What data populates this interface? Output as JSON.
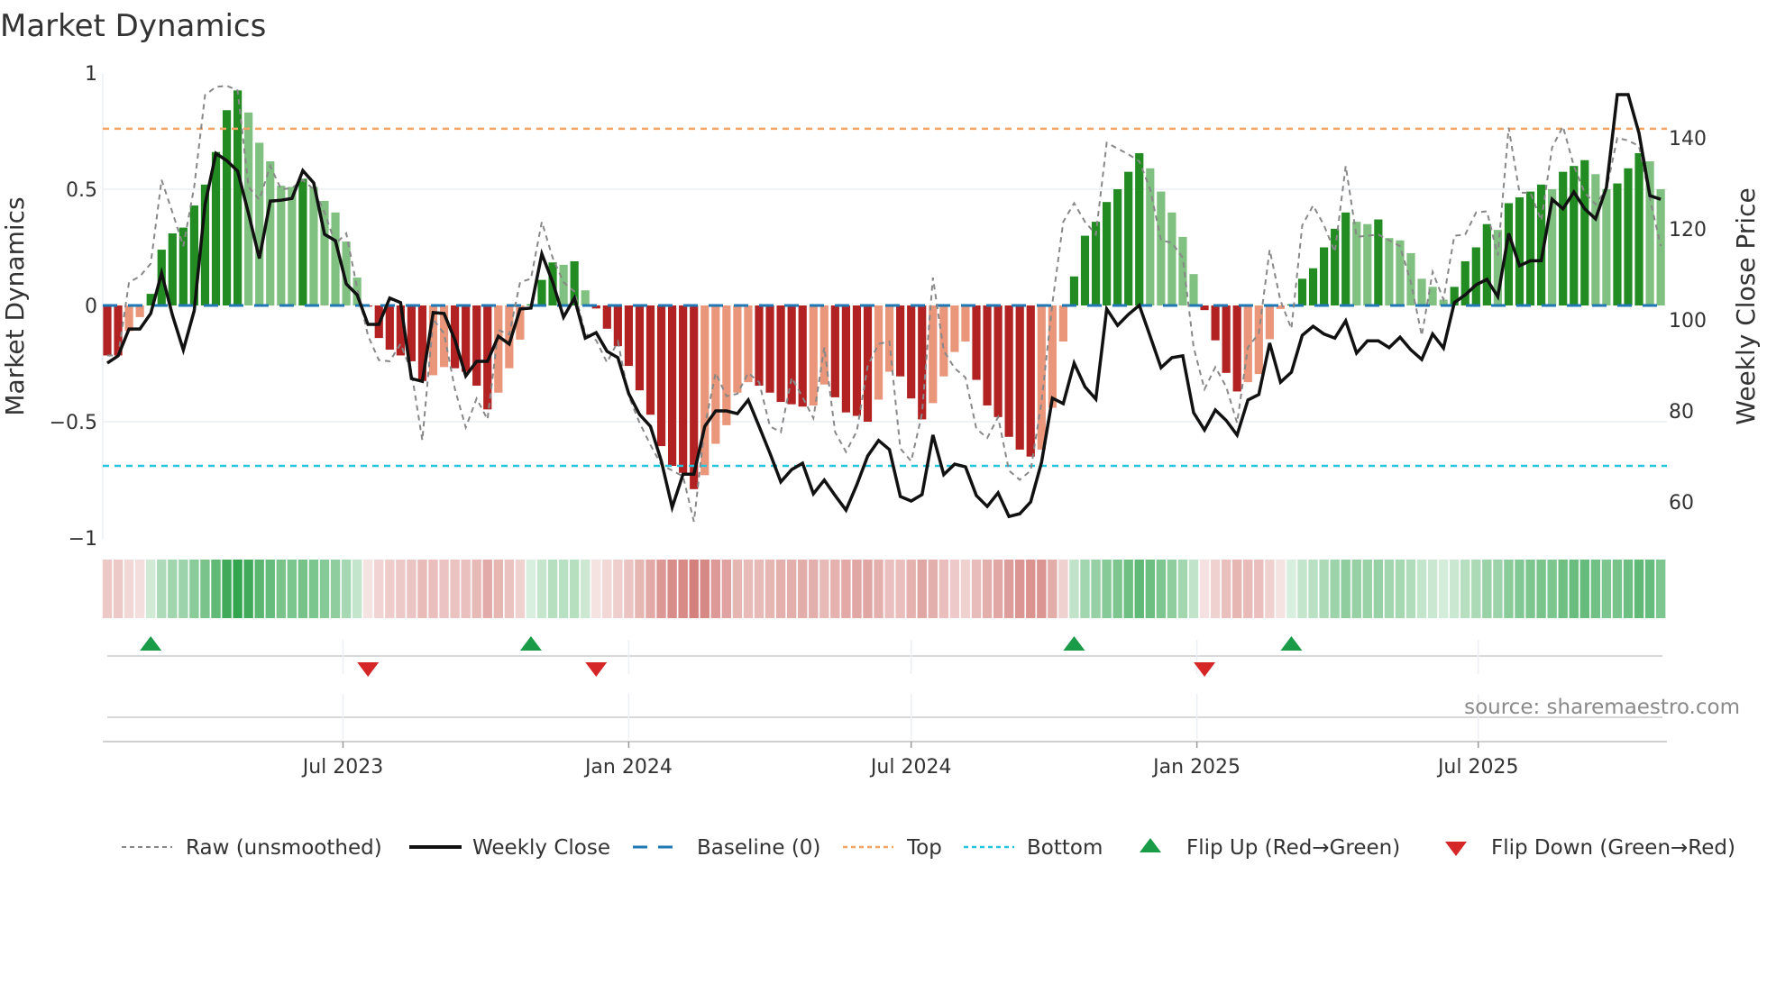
{
  "chart_data": {
    "type": "bar",
    "title": "Market Dynamics",
    "ylabel": "Market Dynamics",
    "ylabel_right": "Weekly Close Price",
    "ylim": [
      -1,
      1
    ],
    "ylim_right": [
      52,
      154
    ],
    "yticks": [
      {
        "v": 1,
        "label": "1"
      },
      {
        "v": 0.5,
        "label": "0.5"
      },
      {
        "v": 0,
        "label": "0"
      },
      {
        "v": -0.5,
        "label": "−0.5"
      },
      {
        "v": -1,
        "label": "−1"
      }
    ],
    "yticks_right": [
      {
        "v": 140,
        "label": "140"
      },
      {
        "v": 120,
        "label": "120"
      },
      {
        "v": 100,
        "label": "100"
      },
      {
        "v": 80,
        "label": "80"
      },
      {
        "v": 60,
        "label": "60"
      }
    ],
    "xticks": [
      {
        "week": 21.7,
        "label": "Jul 2023"
      },
      {
        "week": 48.0,
        "label": "Jan 2024"
      },
      {
        "week": 74.0,
        "label": "Jul 2024"
      },
      {
        "week": 100.3,
        "label": "Jan 2025"
      },
      {
        "week": 126.2,
        "label": "Jul 2025"
      }
    ],
    "top_threshold": 0.76,
    "bottom_threshold": -0.69,
    "baseline": 0,
    "smoothed": [
      -0.215,
      -0.215,
      -0.11,
      -0.05,
      0.05,
      0.24,
      0.31,
      0.335,
      0.43,
      0.52,
      0.66,
      0.84,
      0.925,
      0.83,
      0.7,
      0.62,
      0.515,
      0.51,
      0.545,
      0.51,
      0.45,
      0.4,
      0.275,
      0.12,
      -0.005,
      -0.14,
      -0.19,
      -0.215,
      -0.24,
      -0.325,
      -0.3,
      -0.265,
      -0.27,
      -0.285,
      -0.345,
      -0.447,
      -0.375,
      -0.27,
      -0.147,
      0.005,
      0.11,
      0.185,
      0.175,
      0.19,
      0.065,
      -0.013,
      -0.1,
      -0.175,
      -0.26,
      -0.365,
      -0.47,
      -0.605,
      -0.69,
      -0.72,
      -0.79,
      -0.73,
      -0.595,
      -0.515,
      -0.375,
      -0.33,
      -0.345,
      -0.375,
      -0.415,
      -0.425,
      -0.435,
      -0.43,
      -0.34,
      -0.395,
      -0.46,
      -0.475,
      -0.5,
      -0.405,
      -0.285,
      -0.305,
      -0.4,
      -0.49,
      -0.42,
      -0.305,
      -0.2,
      -0.155,
      -0.32,
      -0.43,
      -0.48,
      -0.565,
      -0.62,
      -0.65,
      -0.62,
      -0.44,
      -0.155,
      0.125,
      0.3,
      0.36,
      0.445,
      0.5,
      0.575,
      0.655,
      0.59,
      0.49,
      0.4,
      0.295,
      0.135,
      -0.02,
      -0.15,
      -0.29,
      -0.37,
      -0.33,
      -0.295,
      -0.145,
      -0.015,
      0.005,
      0.115,
      0.16,
      0.25,
      0.33,
      0.4,
      0.36,
      0.35,
      0.37,
      0.29,
      0.28,
      0.225,
      0.115,
      0.08,
      0.025,
      0.08,
      0.19,
      0.25,
      0.35,
      0.325,
      0.44,
      0.465,
      0.49,
      0.52,
      0.5,
      0.575,
      0.6,
      0.625,
      0.565,
      0.5,
      0.525,
      0.59,
      0.655,
      0.62,
      0.5
    ],
    "raw": [
      -0.215,
      -0.215,
      0.1,
      0.125,
      0.18,
      0.54,
      0.4,
      0.255,
      0.51,
      0.905,
      0.94,
      0.945,
      0.925,
      0.51,
      0.455,
      0.6,
      0.5,
      0.505,
      0.54,
      0.5,
      0.4,
      0.265,
      0.31,
      0.075,
      -0.13,
      -0.235,
      -0.24,
      -0.165,
      -0.285,
      -0.58,
      -0.06,
      -0.12,
      -0.36,
      -0.525,
      -0.4,
      -0.49,
      -0.105,
      -0.125,
      0.1,
      0.115,
      0.36,
      0.205,
      0.1,
      0.06,
      -0.12,
      -0.15,
      -0.245,
      -0.155,
      -0.39,
      -0.505,
      -0.6,
      -0.685,
      -0.71,
      -0.735,
      -0.93,
      -0.52,
      -0.29,
      -0.39,
      -0.38,
      -0.29,
      -0.33,
      -0.52,
      -0.545,
      -0.31,
      -0.395,
      -0.485,
      -0.18,
      -0.545,
      -0.63,
      -0.54,
      -0.26,
      -0.165,
      -0.155,
      -0.615,
      -0.67,
      -0.465,
      0.12,
      -0.195,
      -0.27,
      -0.31,
      -0.53,
      -0.57,
      -0.48,
      -0.71,
      -0.75,
      -0.71,
      -0.415,
      0.01,
      0.36,
      0.44,
      0.36,
      0.305,
      0.7,
      0.675,
      0.65,
      0.62,
      0.5,
      0.28,
      0.27,
      0.205,
      -0.18,
      -0.36,
      -0.265,
      -0.35,
      -0.505,
      -0.18,
      -0.12,
      0.24,
      0.02,
      -0.1,
      0.345,
      0.43,
      0.345,
      0.23,
      0.6,
      0.295,
      0.3,
      0.305,
      0.28,
      0.255,
      0.1,
      -0.13,
      0.145,
      0.025,
      0.3,
      0.305,
      0.4,
      0.405,
      0.215,
      0.765,
      0.485,
      0.485,
      0.365,
      0.68,
      0.77,
      0.6,
      0.485,
      0.435,
      0.5,
      0.72,
      0.71,
      0.685,
      0.46,
      0.255
    ],
    "weekly_close": [
      90.5,
      92.1,
      98,
      98,
      101.4,
      110.3,
      101,
      93.4,
      102,
      125.4,
      136.6,
      135,
      132.7,
      123.4,
      113.5,
      126.1,
      126.3,
      126.7,
      132.8,
      130.1,
      118.8,
      117.4,
      107.9,
      105.5,
      99,
      99,
      104.8,
      103.8,
      87.1,
      86.5,
      101.6,
      101.4,
      95.6,
      87.7,
      90.9,
      90.9,
      96.4,
      94.7,
      102.4,
      102.6,
      114.5,
      108.3,
      100.6,
      104.8,
      96,
      97.2,
      93.1,
      91.7,
      83.8,
      79.2,
      76.6,
      69,
      58.8,
      66.1,
      66.1,
      76.6,
      80,
      80,
      79.4,
      82.4,
      76.6,
      70.7,
      64.4,
      67.1,
      68.5,
      61.8,
      64.8,
      61.4,
      58.2,
      63.8,
      70.1,
      73.5,
      71.5,
      61.2,
      60.2,
      61.6,
      74.7,
      66,
      68.3,
      67.7,
      61.4,
      59,
      62,
      56.8,
      57.4,
      60,
      68.7,
      82.8,
      81.6,
      90.5,
      85.3,
      82.6,
      102.4,
      98.8,
      101.2,
      103.2,
      96.4,
      89.5,
      91.7,
      92.1,
      79.6,
      75.8,
      80.2,
      77.9,
      74.7,
      82.4,
      83.6,
      94.9,
      86.3,
      88.5,
      96.6,
      98.6,
      96.9,
      96,
      99.8,
      92.7,
      95.4,
      95.4,
      93.9,
      96.2,
      93.4,
      91.3,
      96.9,
      93.8,
      103.8,
      105.5,
      107.7,
      108.9,
      105.1,
      119,
      111.9,
      113,
      113,
      126.5,
      124.4,
      128.1,
      124.4,
      122.2,
      129.1,
      149.5,
      149.5,
      141,
      127.3,
      126.5
    ],
    "flips_up_week": [
      4,
      39,
      89,
      109
    ],
    "flips_down_week": [
      24,
      45,
      101
    ],
    "legend": {
      "placement": "bottom",
      "items": [
        "Raw (unsmoothed)",
        "Weekly Close",
        "Baseline (0)",
        "Top",
        "Bottom",
        "Flip Up (Red→Green)",
        "Flip Down (Green→Red)"
      ]
    },
    "source": "source: sharemaestro.com",
    "colors": {
      "rising_green": "#228b22",
      "falling_green": "#80c080",
      "falling_red": "#b22222",
      "rising_red": "#e9967a",
      "top": "#f4a460",
      "bottom": "#22c4de",
      "baseline": "#1f77b4",
      "raw": "#888888",
      "close": "#111111",
      "flip_up": "#1a9b48",
      "flip_down": "#d62728"
    }
  }
}
